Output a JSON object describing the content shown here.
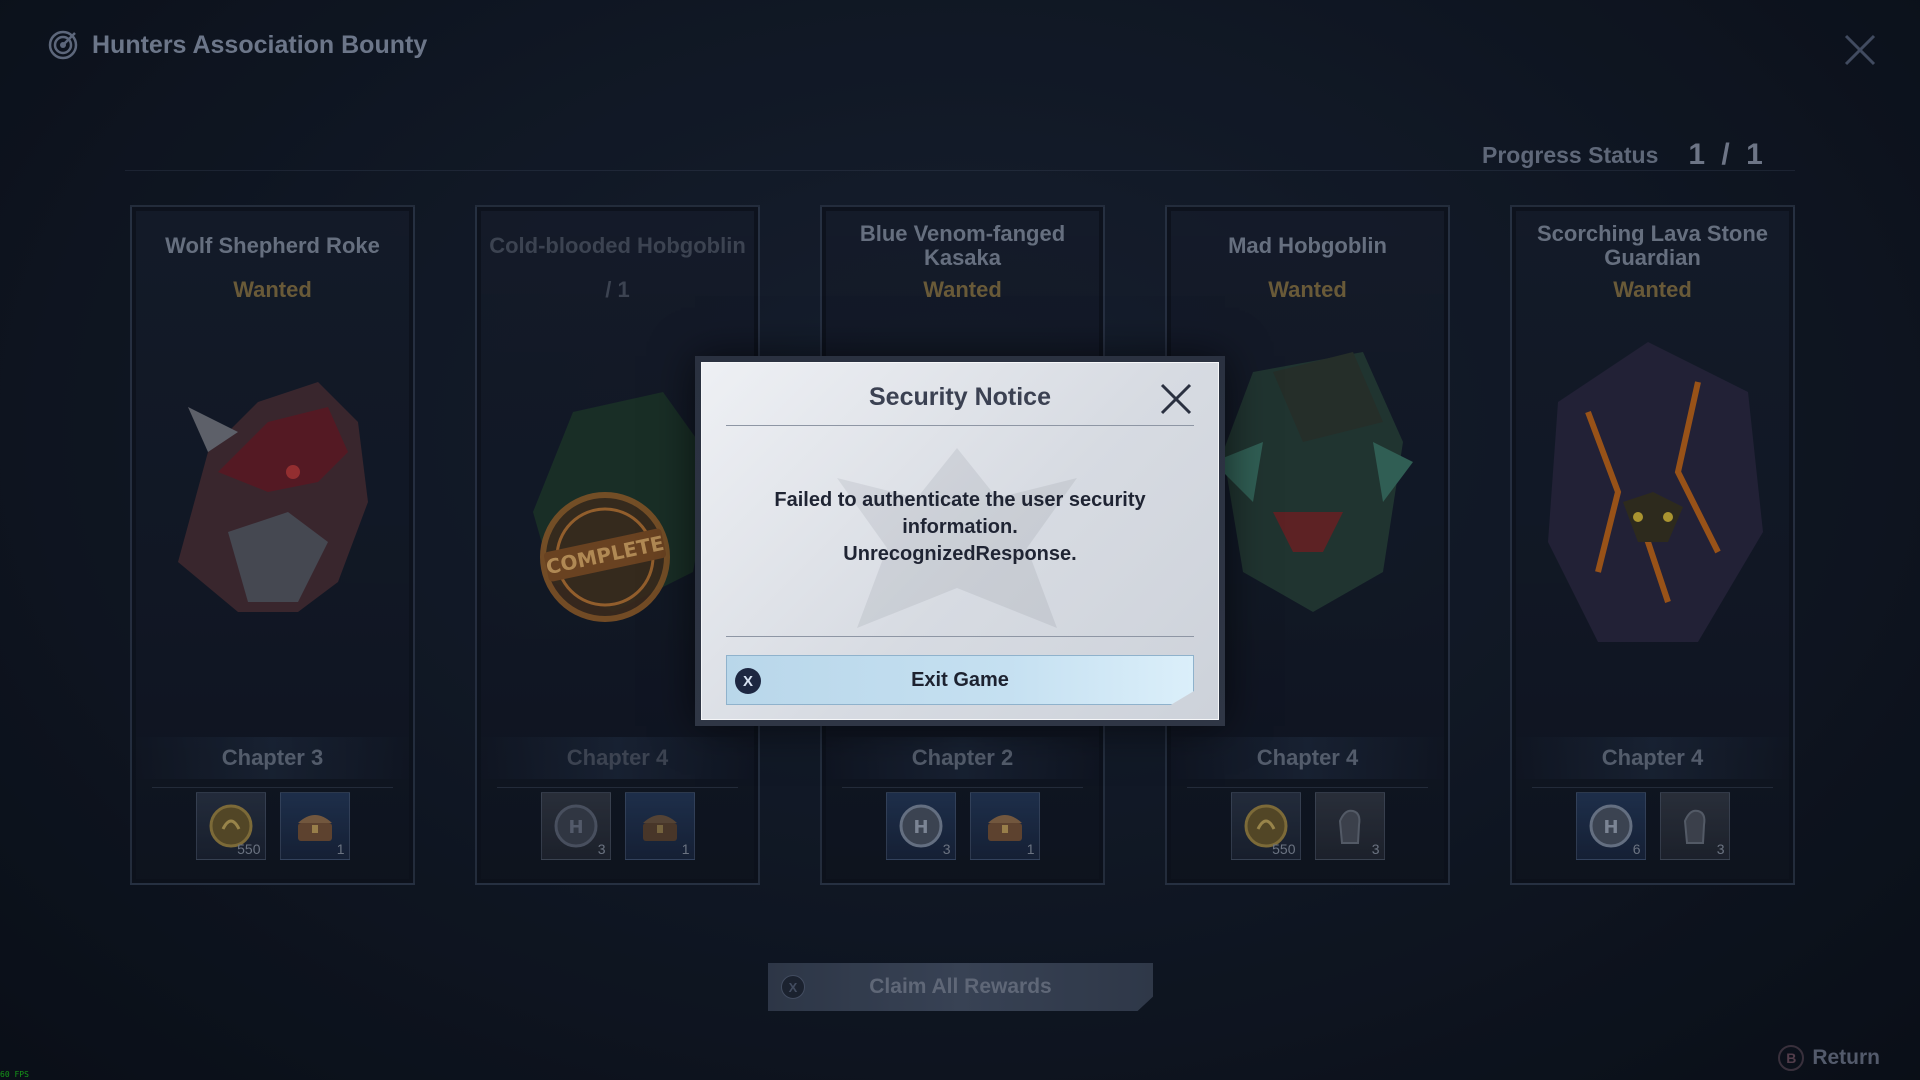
{
  "header": {
    "title": "Hunters Association Bounty"
  },
  "progress": {
    "label": "Progress Status",
    "value": "1 / 1"
  },
  "cards": [
    {
      "name": "Wolf Shepherd Roke",
      "status": "Wanted",
      "chapter": "Chapter 3",
      "rewards": [
        {
          "icon": "gold-coin-icon",
          "count": "550"
        },
        {
          "icon": "treasure-chest-icon",
          "count": "1"
        }
      ]
    },
    {
      "name": "Cold-blooded Hobgoblin",
      "status": "/ 1",
      "chapter": "Chapter 4",
      "stamp": "COMPLETE",
      "rewards": [
        {
          "icon": "hunter-token-icon",
          "count": "3"
        },
        {
          "icon": "treasure-chest-icon",
          "count": "1"
        }
      ]
    },
    {
      "name": "Blue Venom-fanged Kasaka",
      "status": "Wanted",
      "chapter": "Chapter 2",
      "rewards": [
        {
          "icon": "hunter-token-icon",
          "count": "3"
        },
        {
          "icon": "treasure-chest-icon",
          "count": "1"
        }
      ]
    },
    {
      "name": "Mad Hobgoblin",
      "status": "Wanted",
      "chapter": "Chapter 4",
      "rewards": [
        {
          "icon": "gold-coin-icon",
          "count": "550"
        },
        {
          "icon": "gauntlet-icon",
          "count": "3"
        }
      ]
    },
    {
      "name": "Scorching Lava Stone Guardian",
      "status": "Wanted",
      "chapter": "Chapter 4",
      "rewards": [
        {
          "icon": "hunter-token-icon",
          "count": "6"
        },
        {
          "icon": "gauntlet-icon",
          "count": "3"
        }
      ]
    }
  ],
  "claim": {
    "label": "Claim All Rewards",
    "key": "X"
  },
  "return_btn": {
    "label": "Return",
    "key": "B"
  },
  "fps": "60 FPS",
  "dialog": {
    "title": "Security Notice",
    "message_lines": [
      "Failed to authenticate the user security",
      "information.",
      "UnrecognizedResponse."
    ],
    "button_label": "Exit Game",
    "button_key": "X"
  },
  "colors": {
    "wanted": "#8a7444",
    "dialog_button": "#c5e0f1",
    "accent_dark": "#1d2741"
  }
}
